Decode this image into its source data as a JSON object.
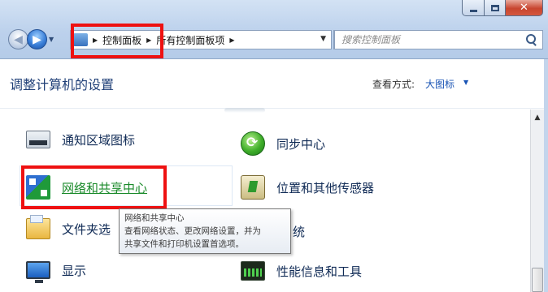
{
  "window": {
    "caption": {
      "minimize": "minimize",
      "maximize": "maximize",
      "close": "✕"
    }
  },
  "nav": {
    "back_icon": "back-arrow-icon",
    "forward_icon": "forward-arrow-icon"
  },
  "address": {
    "crumbs": [
      "控制面板",
      "所有控制面板项"
    ]
  },
  "search": {
    "placeholder": "搜索控制面板"
  },
  "header": {
    "title": "调整计算机的设置",
    "view_label": "查看方式:",
    "view_value": "大图标"
  },
  "items": {
    "notify": "通知区域图标",
    "sync": "同步中心",
    "network": "网络和共享中心",
    "location": "位置和其他传感器",
    "folder": "文件夹选",
    "folder_tail": "统",
    "display": "显示",
    "perf": "性能信息和工具"
  },
  "tooltip": {
    "line1": "网络和共享中心",
    "line2": "查看网络状态、更改网络设置，并为",
    "line3": "共享文件和打印机设置首选项。"
  },
  "colors": {
    "highlight": "#ee1111",
    "link": "#1a54b5",
    "title": "#1f3f77"
  }
}
